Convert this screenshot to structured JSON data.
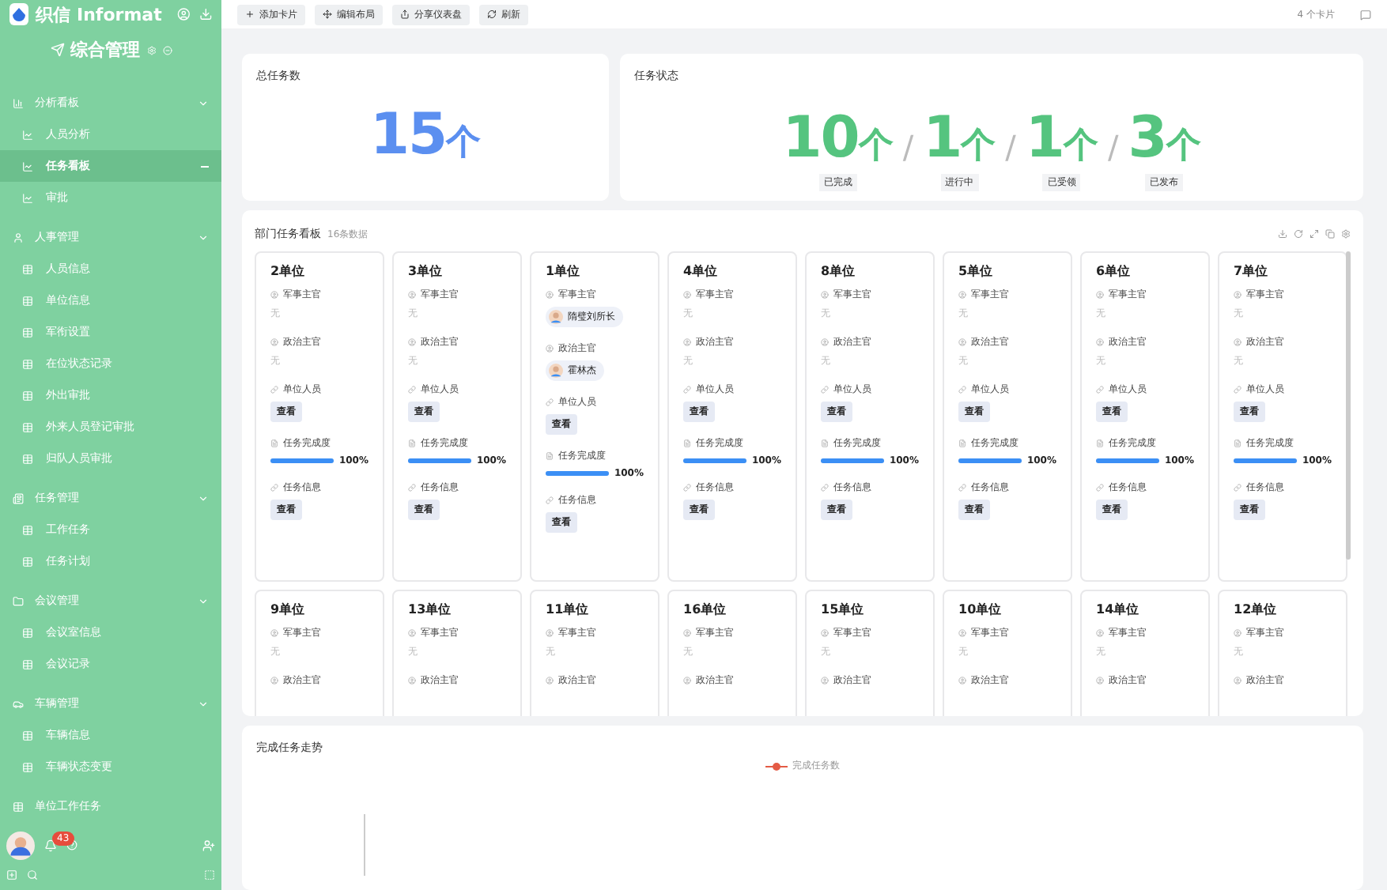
{
  "brand": {
    "logo": "织信 Informat"
  },
  "sidebar": {
    "title": "综合管理",
    "groups": [
      {
        "label": "分析看板",
        "expanded": true,
        "children": [
          {
            "label": "人员分析",
            "selected": false
          },
          {
            "label": "任务看板",
            "selected": true
          },
          {
            "label": "审批",
            "selected": false
          }
        ]
      },
      {
        "label": "人事管理",
        "expanded": true,
        "children": [
          {
            "label": "人员信息",
            "selected": false
          },
          {
            "label": "单位信息",
            "selected": false
          },
          {
            "label": "军衔设置",
            "selected": false
          },
          {
            "label": "在位状态记录",
            "selected": false
          },
          {
            "label": "外出审批",
            "selected": false
          },
          {
            "label": "外来人员登记审批",
            "selected": false
          },
          {
            "label": "归队人员审批",
            "selected": false
          }
        ]
      },
      {
        "label": "任务管理",
        "expanded": true,
        "children": [
          {
            "label": "工作任务",
            "selected": false
          },
          {
            "label": "任务计划",
            "selected": false
          }
        ]
      },
      {
        "label": "会议管理",
        "expanded": true,
        "children": [
          {
            "label": "会议室信息",
            "selected": false
          },
          {
            "label": "会议记录",
            "selected": false
          }
        ]
      },
      {
        "label": "车辆管理",
        "expanded": true,
        "children": [
          {
            "label": "车辆信息",
            "selected": false
          },
          {
            "label": "车辆状态变更",
            "selected": false
          }
        ]
      },
      {
        "label": "单位工作任务",
        "expanded": false
      }
    ],
    "notifications": "43"
  },
  "toolbar": {
    "buttons": [
      "添加卡片",
      "编辑布局",
      "分享仪表盘",
      "刷新"
    ],
    "card_count": "4 个卡片"
  },
  "total": {
    "title": "总任务数",
    "value": "15",
    "unit": "个"
  },
  "status": {
    "title": "任务状态",
    "separator": "/",
    "items": [
      {
        "value": "10",
        "unit": "个",
        "label": "已完成"
      },
      {
        "value": "1",
        "unit": "个",
        "label": "进行中"
      },
      {
        "value": "1",
        "unit": "个",
        "label": "已受领"
      },
      {
        "value": "3",
        "unit": "个",
        "label": "已发布"
      }
    ]
  },
  "board": {
    "title": "部门任务看板",
    "count": "16条数据",
    "units": [
      {
        "name": "2单位",
        "fields": [
          {
            "kind": "person",
            "label": "军事主官",
            "empty": "无"
          },
          {
            "kind": "person",
            "label": "政治主官",
            "empty": "无"
          },
          {
            "kind": "view",
            "label": "单位人员",
            "button": "查看"
          },
          {
            "kind": "progress",
            "label": "任务完成度",
            "level": 1,
            "reading": "100%"
          },
          {
            "kind": "view",
            "label": "任务信息",
            "button": "查看"
          }
        ]
      },
      {
        "name": "3单位",
        "fields": [
          {
            "kind": "person",
            "label": "军事主官",
            "empty": "无"
          },
          {
            "kind": "person",
            "label": "政治主官",
            "empty": "无"
          },
          {
            "kind": "view",
            "label": "单位人员",
            "button": "查看"
          },
          {
            "kind": "progress",
            "label": "任务完成度",
            "level": 1,
            "reading": "100%"
          },
          {
            "kind": "view",
            "label": "任务信息",
            "button": "查看"
          }
        ]
      },
      {
        "name": "1单位",
        "fields": [
          {
            "kind": "person",
            "label": "军事主官",
            "person": "隋璧刘所长"
          },
          {
            "kind": "person",
            "label": "政治主官",
            "person": "霍林杰"
          },
          {
            "kind": "view",
            "label": "单位人员",
            "button": "查看"
          },
          {
            "kind": "progress",
            "label": "任务完成度",
            "level": 1,
            "reading": "100%"
          },
          {
            "kind": "view",
            "label": "任务信息",
            "button": "查看"
          }
        ]
      },
      {
        "name": "4单位",
        "fields": [
          {
            "kind": "person",
            "label": "军事主官",
            "empty": "无"
          },
          {
            "kind": "person",
            "label": "政治主官",
            "empty": "无"
          },
          {
            "kind": "view",
            "label": "单位人员",
            "button": "查看"
          },
          {
            "kind": "progress",
            "label": "任务完成度",
            "level": 1,
            "reading": "100%"
          },
          {
            "kind": "view",
            "label": "任务信息",
            "button": "查看"
          }
        ]
      },
      {
        "name": "8单位",
        "fields": [
          {
            "kind": "person",
            "label": "军事主官",
            "empty": "无"
          },
          {
            "kind": "person",
            "label": "政治主官",
            "empty": "无"
          },
          {
            "kind": "view",
            "label": "单位人员",
            "button": "查看"
          },
          {
            "kind": "progress",
            "label": "任务完成度",
            "level": 1,
            "reading": "100%"
          },
          {
            "kind": "view",
            "label": "任务信息",
            "button": "查看"
          }
        ]
      },
      {
        "name": "5单位",
        "fields": [
          {
            "kind": "person",
            "label": "军事主官",
            "empty": "无"
          },
          {
            "kind": "person",
            "label": "政治主官",
            "empty": "无"
          },
          {
            "kind": "view",
            "label": "单位人员",
            "button": "查看"
          },
          {
            "kind": "progress",
            "label": "任务完成度",
            "level": 1,
            "reading": "100%"
          },
          {
            "kind": "view",
            "label": "任务信息",
            "button": "查看"
          }
        ]
      },
      {
        "name": "6单位",
        "fields": [
          {
            "kind": "person",
            "label": "军事主官",
            "empty": "无"
          },
          {
            "kind": "person",
            "label": "政治主官",
            "empty": "无"
          },
          {
            "kind": "view",
            "label": "单位人员",
            "button": "查看"
          },
          {
            "kind": "progress",
            "label": "任务完成度",
            "level": 1,
            "reading": "100%"
          },
          {
            "kind": "view",
            "label": "任务信息",
            "button": "查看"
          }
        ]
      },
      {
        "name": "7单位",
        "fields": [
          {
            "kind": "person",
            "label": "军事主官",
            "empty": "无"
          },
          {
            "kind": "person",
            "label": "政治主官",
            "empty": "无"
          },
          {
            "kind": "view",
            "label": "单位人员",
            "button": "查看"
          },
          {
            "kind": "progress",
            "label": "任务完成度",
            "level": 1,
            "reading": "100%"
          },
          {
            "kind": "view",
            "label": "任务信息",
            "button": "查看"
          }
        ]
      },
      {
        "name": "9单位",
        "fields": [
          {
            "kind": "person",
            "label": "军事主官",
            "empty": "无"
          },
          {
            "kind": "label",
            "label": "政治主官"
          }
        ]
      },
      {
        "name": "13单位",
        "fields": [
          {
            "kind": "person",
            "label": "军事主官",
            "empty": "无"
          },
          {
            "kind": "label",
            "label": "政治主官"
          }
        ]
      },
      {
        "name": "11单位",
        "fields": [
          {
            "kind": "person",
            "label": "军事主官",
            "empty": "无"
          },
          {
            "kind": "label",
            "label": "政治主官"
          }
        ]
      },
      {
        "name": "16单位",
        "fields": [
          {
            "kind": "person",
            "label": "军事主官",
            "empty": "无"
          },
          {
            "kind": "label",
            "label": "政治主官"
          }
        ]
      },
      {
        "name": "15单位",
        "fields": [
          {
            "kind": "person",
            "label": "军事主官",
            "empty": "无"
          },
          {
            "kind": "label",
            "label": "政治主官"
          }
        ]
      },
      {
        "name": "10单位",
        "fields": [
          {
            "kind": "person",
            "label": "军事主官",
            "empty": "无"
          },
          {
            "kind": "label",
            "label": "政治主官"
          }
        ]
      },
      {
        "name": "14单位",
        "fields": [
          {
            "kind": "person",
            "label": "军事主官",
            "empty": "无"
          },
          {
            "kind": "label",
            "label": "政治主官"
          }
        ]
      },
      {
        "name": "12单位",
        "fields": [
          {
            "kind": "person",
            "label": "军事主官",
            "empty": "无"
          },
          {
            "kind": "label",
            "label": "政治主官"
          }
        ]
      }
    ]
  },
  "trend": {
    "title": "完成任务走势",
    "legend": "完成任务数"
  }
}
